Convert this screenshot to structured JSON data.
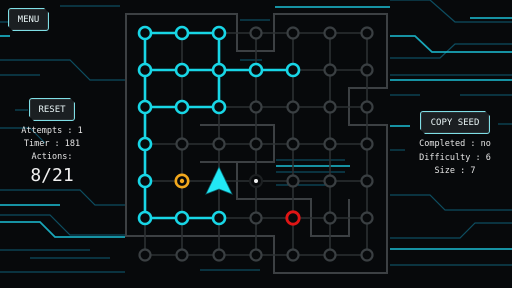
{
  "buttons": {
    "menu": "MENU",
    "reset": "RESET",
    "copy_seed": "COPY SEED"
  },
  "left_stats": {
    "attempts": "Attempts : 1",
    "timer": "Timer : 181",
    "actions_label": "Actions:",
    "actions_count": "8/21"
  },
  "right_stats": {
    "completed": "Completed : no",
    "difficulty": "Difficulty : 6",
    "size": "Size : 7"
  },
  "colors": {
    "background": "#07090b",
    "circuit": "#0e4e63",
    "path_active": "#18d6e6",
    "node_inactive": "#3a3f42",
    "wall": "#3c4043",
    "current_marker": "#f2a81d",
    "target": "#e01515",
    "cursor": "#22e8f5"
  },
  "board": {
    "grid_size": 7,
    "visited_nodes": [
      [
        0,
        0
      ],
      [
        1,
        0
      ],
      [
        2,
        0
      ],
      [
        0,
        1
      ],
      [
        1,
        1
      ],
      [
        2,
        1
      ],
      [
        3,
        1
      ],
      [
        4,
        1
      ],
      [
        0,
        2
      ],
      [
        1,
        2
      ],
      [
        2,
        2
      ],
      [
        0,
        3
      ],
      [
        0,
        4
      ],
      [
        0,
        5
      ],
      [
        1,
        5
      ],
      [
        2,
        5
      ]
    ],
    "active_edges": [
      [
        [
          0,
          0
        ],
        [
          1,
          0
        ]
      ],
      [
        [
          1,
          0
        ],
        [
          2,
          0
        ]
      ],
      [
        [
          0,
          0
        ],
        [
          0,
          1
        ]
      ],
      [
        [
          2,
          0
        ],
        [
          2,
          1
        ]
      ],
      [
        [
          0,
          1
        ],
        [
          1,
          1
        ]
      ],
      [
        [
          1,
          1
        ],
        [
          2,
          1
        ]
      ],
      [
        [
          2,
          1
        ],
        [
          3,
          1
        ]
      ],
      [
        [
          3,
          1
        ],
        [
          4,
          1
        ]
      ],
      [
        [
          0,
          1
        ],
        [
          0,
          2
        ]
      ],
      [
        [
          2,
          1
        ],
        [
          2,
          2
        ]
      ],
      [
        [
          0,
          2
        ],
        [
          1,
          2
        ]
      ],
      [
        [
          1,
          2
        ],
        [
          2,
          2
        ]
      ],
      [
        [
          0,
          2
        ],
        [
          0,
          3
        ]
      ],
      [
        [
          0,
          3
        ],
        [
          0,
          4
        ]
      ],
      [
        [
          0,
          4
        ],
        [
          0,
          5
        ]
      ],
      [
        [
          0,
          5
        ],
        [
          1,
          5
        ]
      ],
      [
        [
          1,
          5
        ],
        [
          2,
          5
        ]
      ]
    ],
    "current_node": [
      1,
      4
    ],
    "target_node": [
      4,
      5
    ],
    "cursor_node": [
      2,
      4
    ],
    "dot_node": [
      3,
      4
    ]
  }
}
